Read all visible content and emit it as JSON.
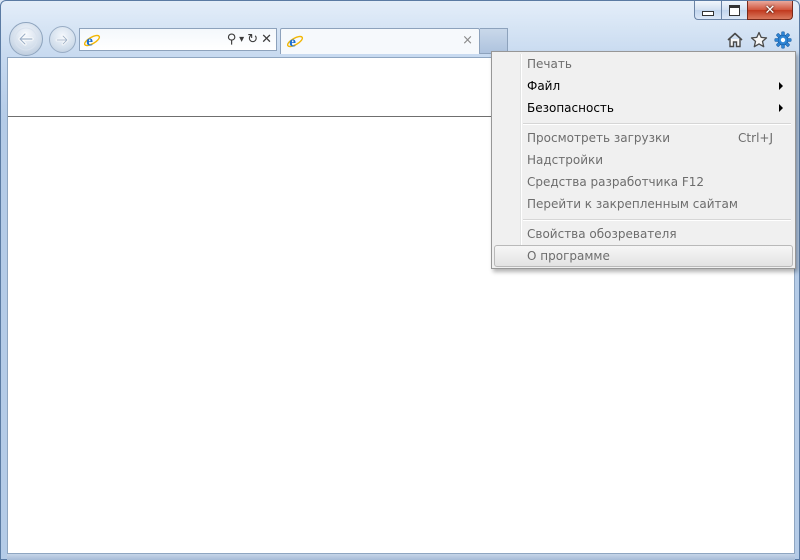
{
  "window": {
    "caption_buttons": {
      "minimize_icon": "minimize-icon",
      "maximize_icon": "maximize-icon",
      "close_glyph": "✕"
    }
  },
  "toolbar": {
    "back_icon": "back-arrow-icon",
    "forward_icon": "forward-arrow-icon",
    "address": {
      "value": "",
      "site_icon": "ie-page-icon",
      "search_glyph": "⚲",
      "dropdown_glyph": "▾",
      "refresh_glyph": "↻",
      "stop_glyph": "✕"
    },
    "tab": {
      "title": "",
      "close_glyph": "×"
    },
    "home_icon": "home-icon",
    "favorites_icon": "star-icon",
    "tools_icon": "gear-icon"
  },
  "tools_menu": {
    "items": [
      {
        "label": "Печать",
        "enabled": false,
        "submenu": false,
        "shortcut": ""
      },
      {
        "label": "Файл",
        "enabled": true,
        "submenu": true,
        "shortcut": ""
      },
      {
        "label": "Безопасность",
        "enabled": true,
        "submenu": true,
        "shortcut": ""
      },
      {
        "label": "Просмотреть загрузки",
        "enabled": false,
        "submenu": false,
        "shortcut": "Ctrl+J"
      },
      {
        "label": "Надстройки",
        "enabled": false,
        "submenu": false,
        "shortcut": ""
      },
      {
        "label": "Средства разработчика F12",
        "enabled": false,
        "submenu": false,
        "shortcut": ""
      },
      {
        "label": "Перейти к закрепленным сайтам",
        "enabled": false,
        "submenu": false,
        "shortcut": ""
      },
      {
        "label": "Свойства обозревателя",
        "enabled": false,
        "submenu": false,
        "shortcut": ""
      },
      {
        "label": "О программе",
        "enabled": false,
        "submenu": false,
        "shortcut": "",
        "hovered": true
      }
    ]
  },
  "colors": {
    "frame": "#b4cbe7",
    "menu_background": "#f0f0f0",
    "disabled_text": "#6d6d6d",
    "enabled_text": "#000000",
    "close_button": "#c1391e",
    "ie_blue": "#1e6fd0",
    "ie_gold": "#f2b705"
  }
}
